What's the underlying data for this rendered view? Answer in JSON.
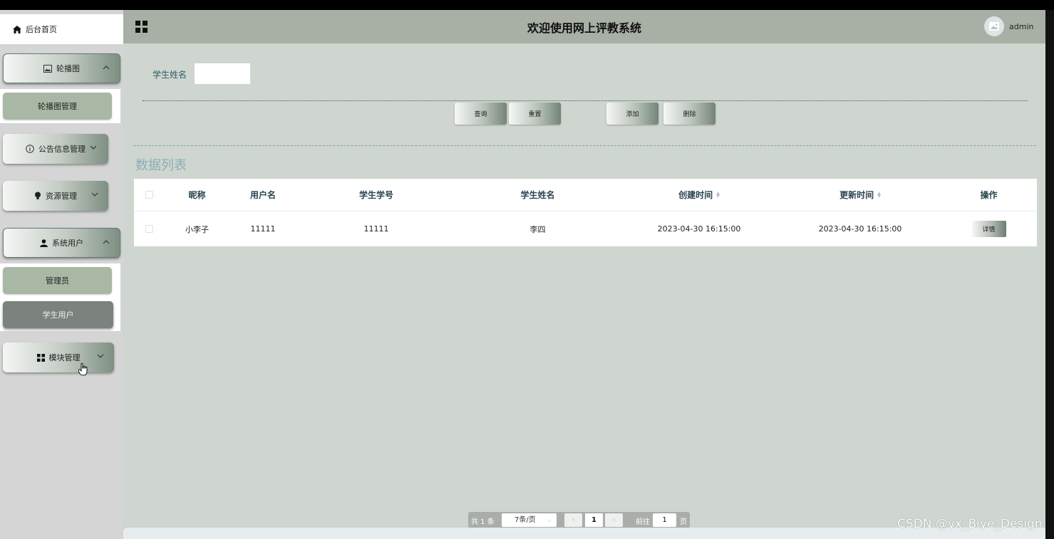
{
  "sidebar": {
    "home_label": "后台首页",
    "menus": [
      {
        "label": "轮播图",
        "icon": "image-icon",
        "expanded": true
      },
      {
        "label": "公告信息管理",
        "icon": "info-circle-icon",
        "expanded": false
      },
      {
        "label": "资源管理",
        "icon": "bulb-icon",
        "expanded": false
      },
      {
        "label": "系统用户",
        "icon": "user-icon",
        "expanded": true
      },
      {
        "label": "模块管理",
        "icon": "grid-icon",
        "expanded": false
      }
    ],
    "submenus": {
      "carousel": [
        "轮播图管理"
      ],
      "system_users": [
        "管理员",
        "学生用户"
      ]
    }
  },
  "header": {
    "title": "欢迎使用网上评教系统",
    "username": "admin"
  },
  "search": {
    "label": "学生姓名",
    "value": "",
    "placeholder": ""
  },
  "actions": {
    "query": "查询",
    "reset": "重置",
    "add": "添加",
    "delete": "删除"
  },
  "section_title": "数据列表",
  "table": {
    "columns": [
      "昵称",
      "用户名",
      "学生学号",
      "学生姓名",
      "创建时间",
      "更新时间",
      "操作"
    ],
    "rows": [
      {
        "nickname": "小李子",
        "username": "11111",
        "student_no": "11111",
        "student_name": "李四",
        "created": "2023-04-30 16:15:00",
        "updated": "2023-04-30 16:15:00",
        "action": "详情"
      }
    ]
  },
  "pagination": {
    "total": "共 1 条",
    "page_size": "7条/页",
    "current_page": "1",
    "goto_label": "前往",
    "goto_value": "1",
    "page_unit": "页"
  },
  "watermark": "CSDN @vx_Biye_Design",
  "colors": {
    "header_bg": "#a8afa5",
    "content_bg": "#cfd5cf",
    "submenu_bg": "#a9b8a5",
    "submenu_active_bg": "#7c827d",
    "section_title": "#8ab0b3"
  }
}
